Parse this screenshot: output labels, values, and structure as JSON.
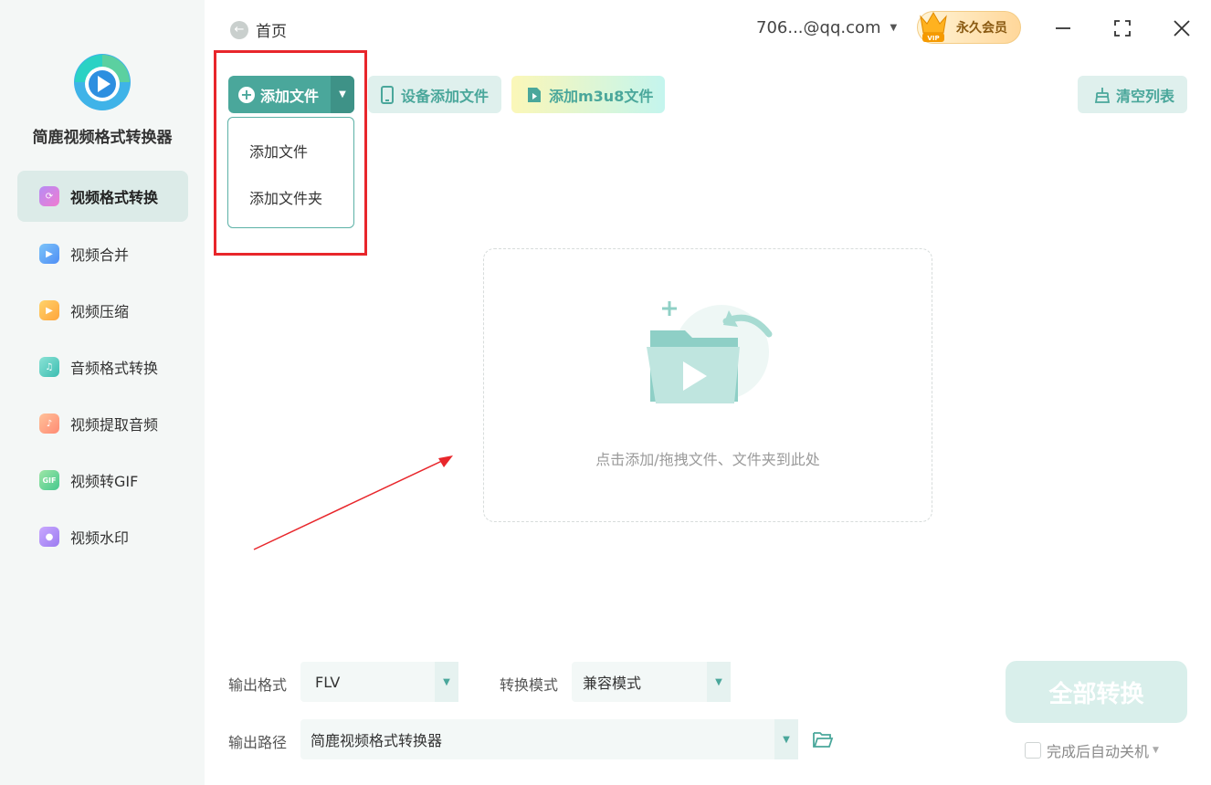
{
  "app": {
    "name": "简鹿视频格式转换器"
  },
  "sidebar": {
    "items": [
      {
        "label": "视频格式转换",
        "icon": "video-convert-icon",
        "active": true
      },
      {
        "label": "视频合并",
        "icon": "video-merge-icon"
      },
      {
        "label": "视频压缩",
        "icon": "video-compress-icon"
      },
      {
        "label": "音频格式转换",
        "icon": "audio-convert-icon"
      },
      {
        "label": "视频提取音频",
        "icon": "extract-audio-icon"
      },
      {
        "label": "视频转GIF",
        "icon": "gif-icon"
      },
      {
        "label": "视频水印",
        "icon": "watermark-icon"
      }
    ]
  },
  "header": {
    "home_label": "首页",
    "account": "706...@qq.com",
    "vip_label": "永久会员",
    "vip_badge": "VIP"
  },
  "toolbar": {
    "add_file": "添加文件",
    "device_add": "设备添加文件",
    "add_m3u8": "添加m3u8文件",
    "clear_list": "清空列表"
  },
  "dropdown": {
    "items": [
      "添加文件",
      "添加文件夹"
    ]
  },
  "dropzone": {
    "hint": "点击添加/拖拽文件、文件夹到此处"
  },
  "footer": {
    "output_format_label": "输出格式",
    "output_format_value": "FLV",
    "mode_label": "转换模式",
    "mode_value": "兼容模式",
    "output_path_label": "输出路径",
    "output_path_value": "简鹿视频格式转换器",
    "convert_all": "全部转换",
    "shutdown_label": "完成后自动关机"
  },
  "colors": {
    "accent": "#4aa79b",
    "accent_light": "#dff0ed",
    "highlight": "#e8262b",
    "sidebar_bg": "#f4f7f6"
  }
}
